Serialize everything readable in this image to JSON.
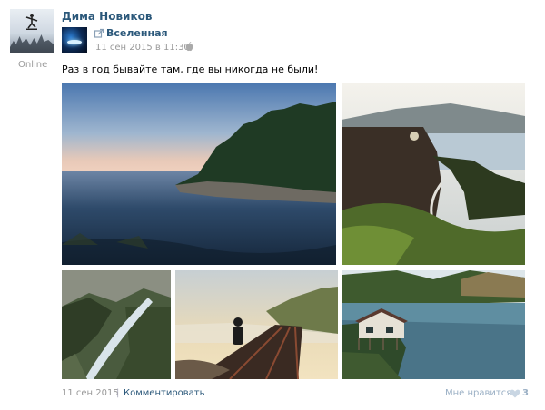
{
  "author": {
    "name": "Дима Новиков",
    "status": "Online"
  },
  "source": {
    "name": "Вселенная",
    "time": "11 сен 2015 в 11:30"
  },
  "post": {
    "text": "Раз в год бывайте там, где вы никогда не были!"
  },
  "photos": [
    "coast-sunset",
    "mountain-road",
    "river-forest",
    "person-on-rails",
    "lake-house"
  ],
  "footer": {
    "date": "11 сен 2015",
    "separator": "|",
    "comment": "Комментировать",
    "like": "Мне нравится",
    "likes_count": "3"
  },
  "colors": {
    "link": "#2b587a",
    "muted": "#999999",
    "like": "#9bb0c5"
  }
}
